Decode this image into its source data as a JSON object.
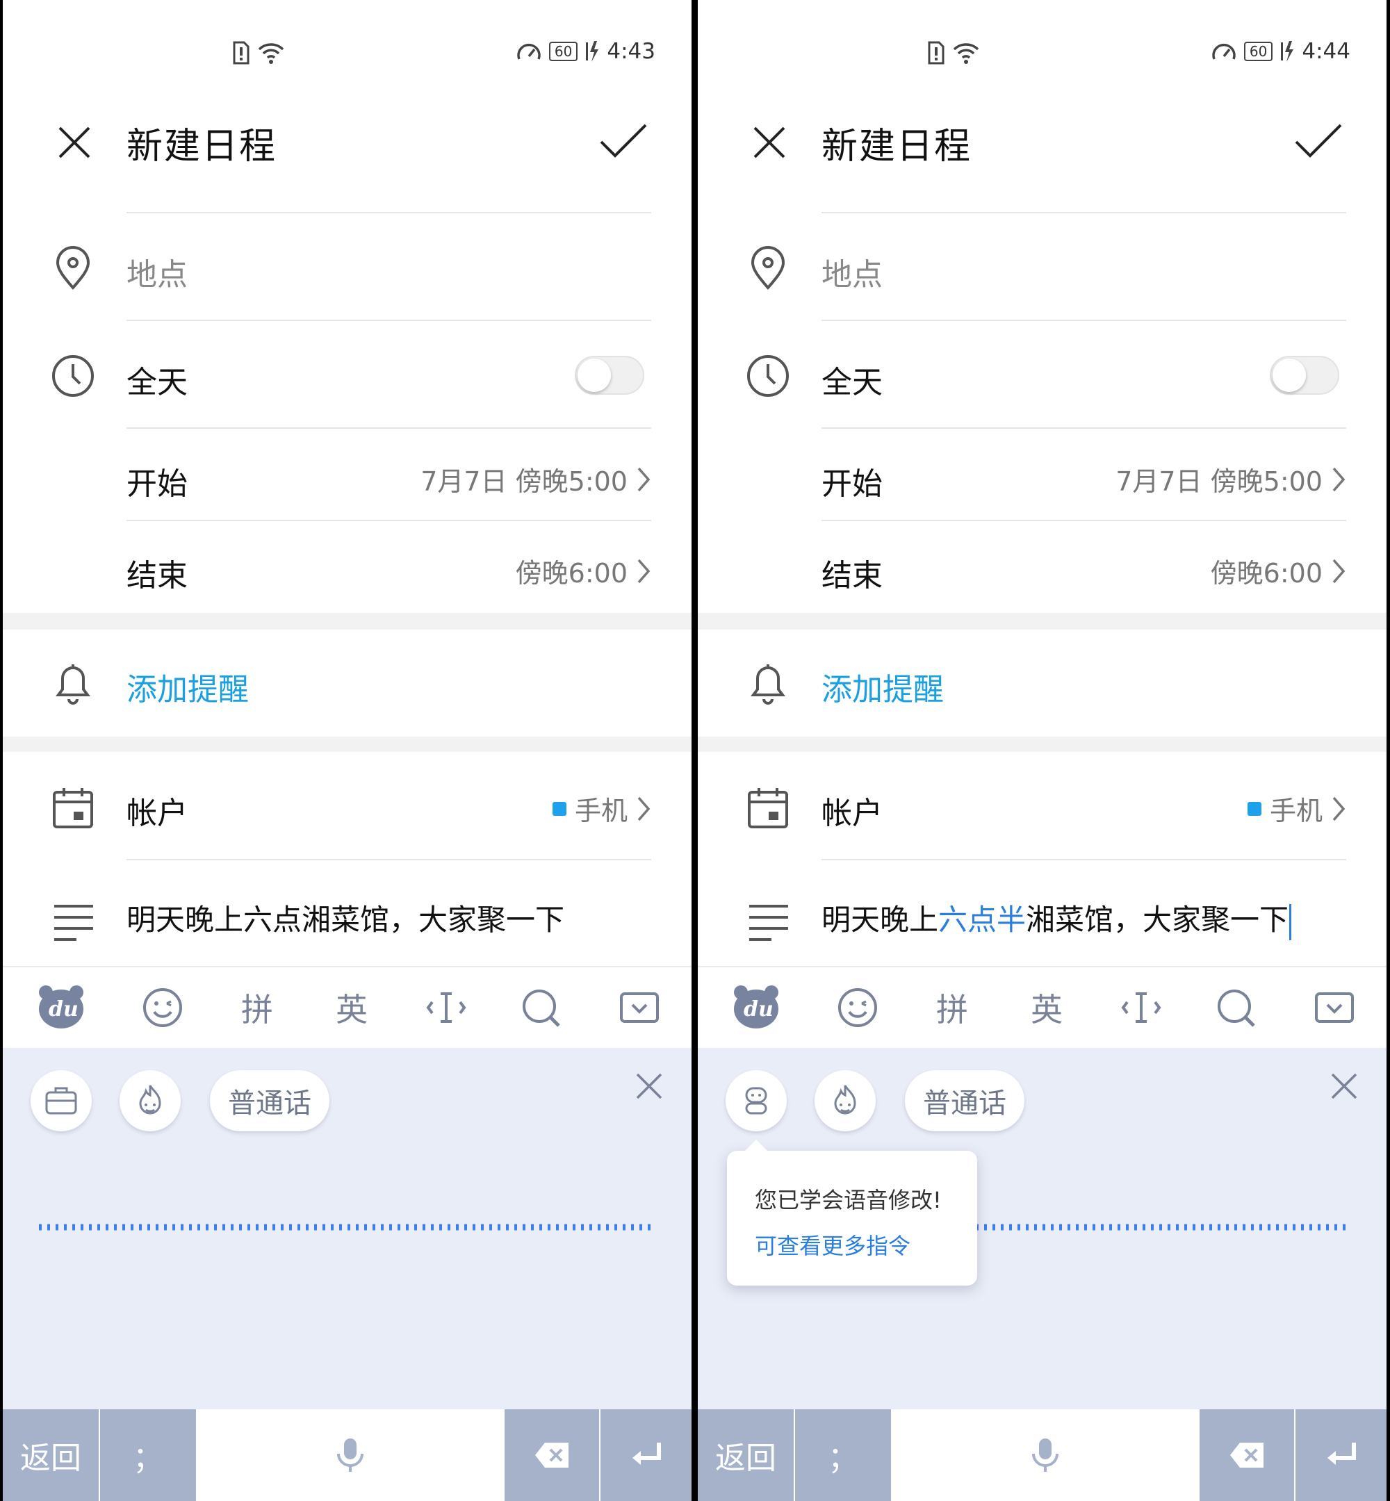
{
  "panels": [
    {
      "status": {
        "time": "4:43",
        "battery": "60"
      },
      "header": {
        "title": "新建日程"
      },
      "location": {
        "placeholder": "地点"
      },
      "allday": {
        "label": "全天"
      },
      "start": {
        "label": "开始",
        "value": "7月7日 傍晚5:00"
      },
      "end": {
        "label": "结束",
        "value": "傍晚6:00"
      },
      "reminder": {
        "label": "添加提醒"
      },
      "account": {
        "label": "帐户",
        "value": "手机"
      },
      "note": {
        "part1": "明天晚上六点湘菜馆，大家聚一下",
        "highlight": "",
        "part2": ""
      },
      "keyboard": {
        "pinyin": "拼",
        "english": "英",
        "dialect": "普通话",
        "back": "返回",
        "semicolon": "；"
      }
    },
    {
      "status": {
        "time": "4:44",
        "battery": "60"
      },
      "header": {
        "title": "新建日程"
      },
      "location": {
        "placeholder": "地点"
      },
      "allday": {
        "label": "全天"
      },
      "start": {
        "label": "开始",
        "value": "7月7日 傍晚5:00"
      },
      "end": {
        "label": "结束",
        "value": "傍晚6:00"
      },
      "reminder": {
        "label": "添加提醒"
      },
      "account": {
        "label": "帐户",
        "value": "手机"
      },
      "note": {
        "part1": "明天晚上",
        "highlight": "六点半",
        "part2": "湘菜馆，大家聚一下"
      },
      "keyboard": {
        "pinyin": "拼",
        "english": "英",
        "dialect": "普通话",
        "back": "返回",
        "semicolon": "；"
      },
      "tooltip": {
        "line1": "您已学会语音修改!",
        "line2": "可查看更多指令"
      }
    }
  ],
  "colors": {
    "accent": "#1aa0e0",
    "keyboard_bg": "#e9edf7",
    "key_gray": "#a6b1ca",
    "highlight": "#2a7ee0"
  }
}
